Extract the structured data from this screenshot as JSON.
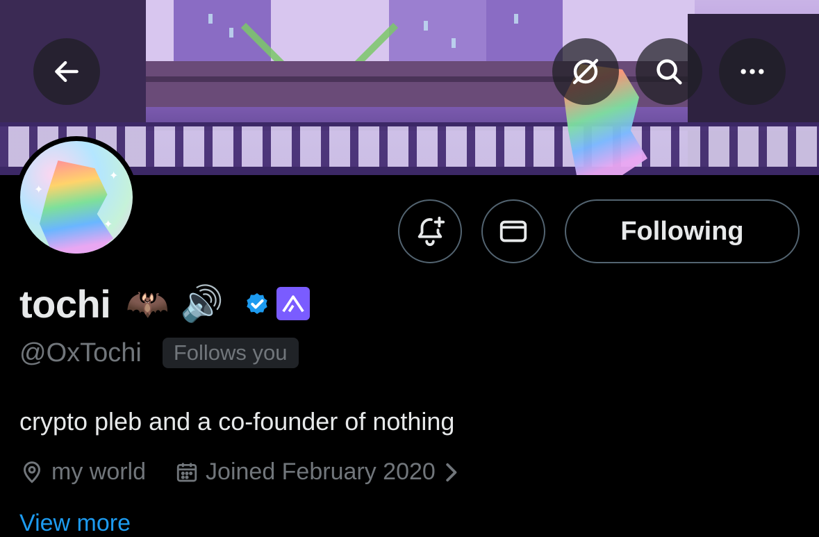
{
  "header": {
    "back_icon": "arrow-left-icon",
    "grok_icon": "grok-slash-icon",
    "search_icon": "search-icon",
    "more_icon": "more-horizontal-icon"
  },
  "profile": {
    "display_name": "tochi",
    "name_emojis": [
      "🦇",
      "🔊"
    ],
    "verified_badge": "verified-checkmark-icon",
    "affiliation_badge": "affiliate-logo-icon",
    "handle": "@OxTochi",
    "follows_you": "Follows you",
    "bio": "crypto pleb and a co-founder of nothing",
    "location": "my world",
    "joined": "Joined February 2020",
    "view_more": "View more"
  },
  "actions": {
    "notify_icon": "bell-plus-icon",
    "message_icon": "mail-icon",
    "following_label": "Following"
  },
  "colors": {
    "background": "#000000",
    "text_primary": "#e7e9ea",
    "text_secondary": "#71767b",
    "border": "#536471",
    "link": "#1d9bf0",
    "verified": "#1d9bf0",
    "affiliate": "#7a5cff"
  }
}
